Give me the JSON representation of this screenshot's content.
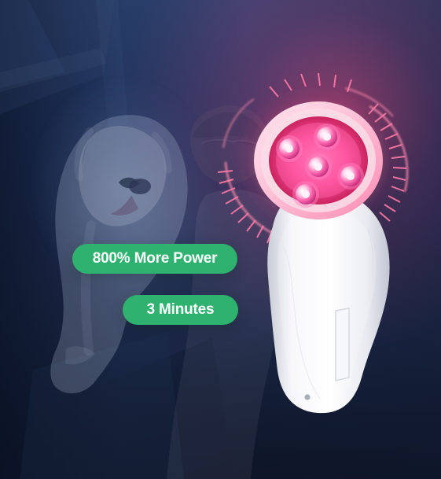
{
  "hero": {
    "badges": [
      {
        "label": "800% More Power"
      },
      {
        "label": "3 Minutes"
      }
    ]
  },
  "colors": {
    "badge_green": "#2fb26f",
    "background_navy": "#1d2d4f",
    "glow_pink": "#ff5a9b",
    "device_white": "#f3f3f6",
    "led_pink": "#ff4c9f"
  },
  "icons": [
    "dog-photo",
    "person-photo",
    "red-light-device-icon",
    "glow-ring-icon"
  ]
}
